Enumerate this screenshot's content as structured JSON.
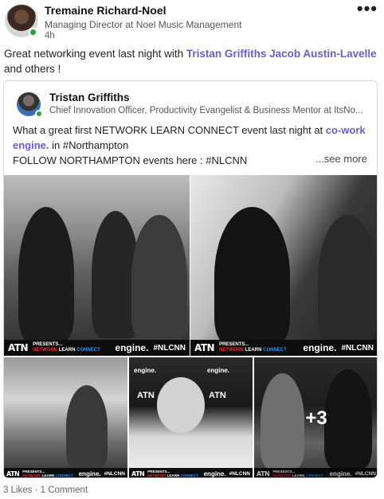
{
  "post": {
    "author_name": "Tremaine Richard-Noel",
    "author_headline": "Managing Director at Noel Music Management",
    "time": "4h",
    "more_icon": "•••",
    "text_before": "Great networking event last night with ",
    "mention_1": "Tristan Griffiths",
    "mention_2": "Jacob Austin-Lavelle",
    "text_after": "and others !"
  },
  "shared": {
    "author_name": "Tristan Griffiths",
    "author_headline": "Chief Innovation Officer, Productivity Evangelist & Business Mentor at ItsNo...",
    "text_line1": "What a great first NETWORK LEARN CONNECT event last night at ",
    "mention": "co-work engine.",
    "text_line2": " in #Northampton",
    "text_line3": "FOLLOW NORTHAMPTON events here : #NLCNN",
    "see_more": "...see more"
  },
  "photos": {
    "banner": {
      "logo": "ATN",
      "presents": "PRESENTS...",
      "network": "NETWORK",
      "learn": "LEARN",
      "connect": "CONNECT",
      "engine": "engine.",
      "tag": "#NLCNN"
    },
    "more_count": "+3",
    "backdrop_engine": "engine.",
    "backdrop_logo": "ATN"
  },
  "social": {
    "counts": "3 Likes · 1 Comment"
  },
  "colors": {
    "mention": "#6b5bd3",
    "presence": "#2e9e3f"
  }
}
